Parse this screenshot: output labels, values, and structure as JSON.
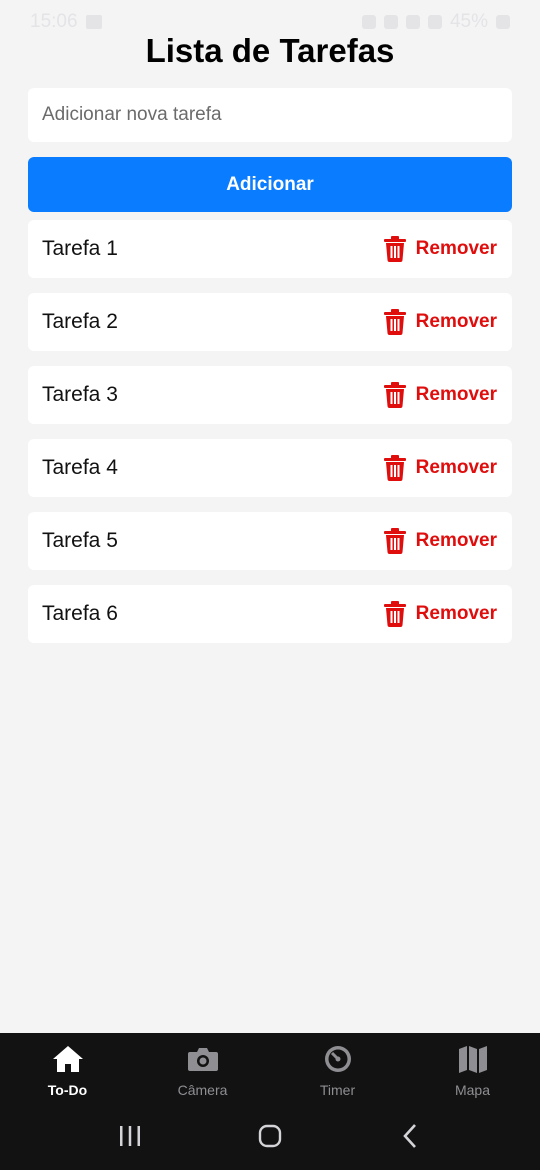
{
  "status_bar": {
    "time": "15:06",
    "battery": "45%"
  },
  "header": {
    "title": "Lista de Tarefas"
  },
  "form": {
    "placeholder": "Adicionar nova tarefa",
    "value": "",
    "add_label": "Adicionar"
  },
  "tasks": [
    {
      "text": "Tarefa 1",
      "remove_label": "Remover"
    },
    {
      "text": "Tarefa 2",
      "remove_label": "Remover"
    },
    {
      "text": "Tarefa 3",
      "remove_label": "Remover"
    },
    {
      "text": "Tarefa 4",
      "remove_label": "Remover"
    },
    {
      "text": "Tarefa 5",
      "remove_label": "Remover"
    },
    {
      "text": "Tarefa 6",
      "remove_label": "Remover"
    }
  ],
  "tabs": [
    {
      "label": "To-Do",
      "icon": "home-icon",
      "active": true
    },
    {
      "label": "Câmera",
      "icon": "camera-icon",
      "active": false
    },
    {
      "label": "Timer",
      "icon": "timer-icon",
      "active": false
    },
    {
      "label": "Mapa",
      "icon": "map-icon",
      "active": false
    }
  ],
  "colors": {
    "accent": "#0a7cff",
    "danger": "#e00d0d",
    "tab_bar": "#121212",
    "background": "#f4f4f5"
  }
}
